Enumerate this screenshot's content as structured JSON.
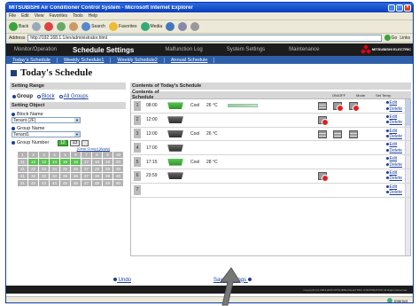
{
  "window": {
    "title": "MITSUBISHI Air Conditioner Control System - Microsoft Internet Explorer"
  },
  "menu": [
    "File",
    "Edit",
    "View",
    "Favorites",
    "Tools",
    "Help"
  ],
  "toolbar": {
    "back": "Back",
    "search": "Search",
    "favorites": "Favorites",
    "media": "Media"
  },
  "address": {
    "label": "Address",
    "url": "http://192.168.1.1/en/administrator.html",
    "go": "Go",
    "links": "Links"
  },
  "nav": {
    "items": [
      "Monitor/Operation",
      "Schedule Settings",
      "Malfunction Log",
      "System Settings",
      "Maintenance"
    ],
    "active_index": 1,
    "brand": "MITSUBISHI ELECTRIC"
  },
  "subnav": [
    "Today's Schedule",
    "Weekly Schedule1",
    "Weekly Schedule2",
    "Annual Schedule"
  ],
  "page": {
    "title": "Today's Schedule"
  },
  "setting_range": {
    "header": "Setting Range",
    "options": [
      "Group",
      "Block",
      "All Groups"
    ],
    "selected": "Group"
  },
  "setting_object": {
    "header": "Setting Object",
    "block_label": "Block Name",
    "block_value": "Tenant (2F)",
    "group_label": "Group Name",
    "group_value": "Tenant1",
    "group_number_label": "Group Number",
    "group_numbers": [
      "12",
      "13"
    ],
    "clear_links": "[Clear Group]  [Apply]",
    "grid": [
      "1",
      "2",
      "3",
      "4",
      "5",
      "6",
      "7",
      "8",
      "9",
      "10",
      "11",
      "12",
      "13",
      "14",
      "15",
      "16",
      "17",
      "18",
      "19",
      "20",
      "21",
      "22",
      "23",
      "24",
      "25",
      "26",
      "27",
      "28",
      "29",
      "30",
      "31",
      "32",
      "33",
      "34",
      "35",
      "36",
      "37",
      "38",
      "39",
      "40",
      "41",
      "42",
      "43",
      "44",
      "45",
      "46",
      "47",
      "48",
      "49",
      "50"
    ],
    "grid_on": [
      "12",
      "13",
      "14",
      "15",
      "16"
    ]
  },
  "contents": {
    "header": "Contents of Today's Schedule",
    "sub_header": "Contents of Schedule",
    "col_onoff": "ON/OFF",
    "col_mode": "Mode",
    "col_settemp": "Set Temp.",
    "rows": [
      {
        "num": "1",
        "time": "08:00",
        "unit": "green",
        "mode": "Cool",
        "temp": "26 °C",
        "bar": true,
        "icons": [
          "gry",
          "no",
          "no"
        ]
      },
      {
        "num": "2",
        "time": "12:00",
        "unit": "dark",
        "mode": "",
        "temp": "",
        "bar": false,
        "icons": [
          "no"
        ]
      },
      {
        "num": "3",
        "time": "13:00",
        "unit": "dark",
        "mode": "Cool",
        "temp": "26 °C",
        "bar": false,
        "icons": [
          "gry",
          "gry",
          "gry"
        ]
      },
      {
        "num": "4",
        "time": "17:00",
        "unit": "dark",
        "mode": "",
        "temp": "",
        "bar": false,
        "icons": []
      },
      {
        "num": "5",
        "time": "17:15",
        "unit": "green",
        "mode": "Cool",
        "temp": "28 °C",
        "bar": false,
        "icons": []
      },
      {
        "num": "6",
        "time": "23:59",
        "unit": "dark",
        "mode": "",
        "temp": "",
        "bar": false,
        "icons": [
          "no"
        ]
      },
      {
        "num": "7",
        "time": "",
        "unit": "",
        "mode": "",
        "temp": "",
        "bar": false,
        "icons": []
      }
    ],
    "edit_label": "Edit",
    "delete_label": "Delete"
  },
  "footer": {
    "undo": "Undo",
    "save": "Save Settings",
    "copyright": "Copyright (C) 2003-2006 MITSUBISHI ELECTRIC CORPORATION All Rights Reserved."
  },
  "status": {
    "zone": "Internet"
  }
}
